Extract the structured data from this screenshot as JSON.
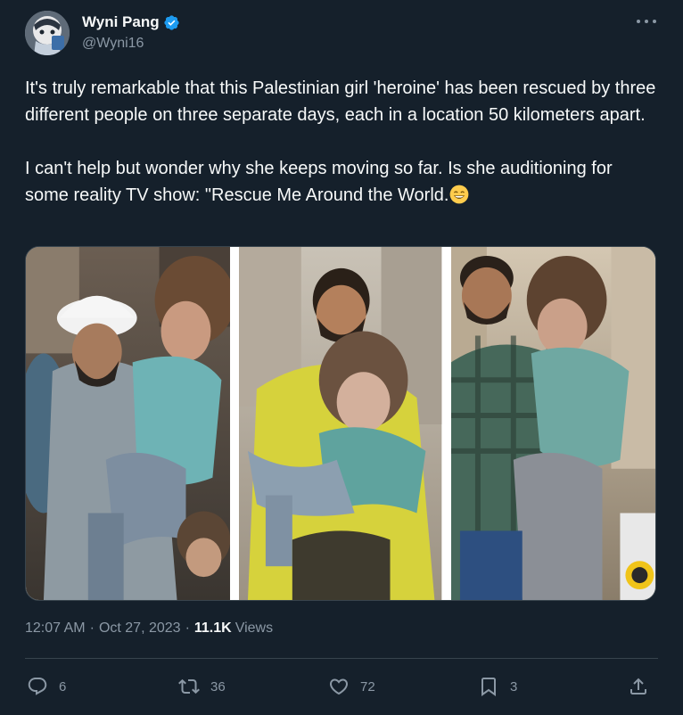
{
  "author": {
    "display_name": "Wyni Pang",
    "handle": "@Wyni16",
    "verified_color": "#1d9bf0"
  },
  "tweet": {
    "paragraph_1": "It's truly remarkable that this Palestinian girl 'heroine' has been rescued by three different people on three separate days, each in a location 50 kilometers apart.",
    "paragraph_2": "I can't help but wonder why she keeps moving so far. Is she auditioning for some reality TV show: \"Rescue Me Around the World.",
    "emoji": "grinning-face-with-smiling-eyes"
  },
  "media": {
    "panels": [
      "rescuer-white-helmet-holding-girl",
      "rescuer-yellow-shirt-carrying-girl",
      "rescuer-plaid-shirt-holding-girl"
    ]
  },
  "meta": {
    "time": "12:07 AM",
    "date": "Oct 27, 2023",
    "separator": "·",
    "views_count": "11.1K",
    "views_label": "Views"
  },
  "actions": {
    "replies": "6",
    "reposts": "36",
    "likes": "72",
    "bookmarks": "3"
  },
  "colors": {
    "background": "#15202b",
    "text_primary": "#f7f9f9",
    "text_secondary": "#8b98a5",
    "border": "#38444d",
    "accent": "#1d9bf0"
  }
}
